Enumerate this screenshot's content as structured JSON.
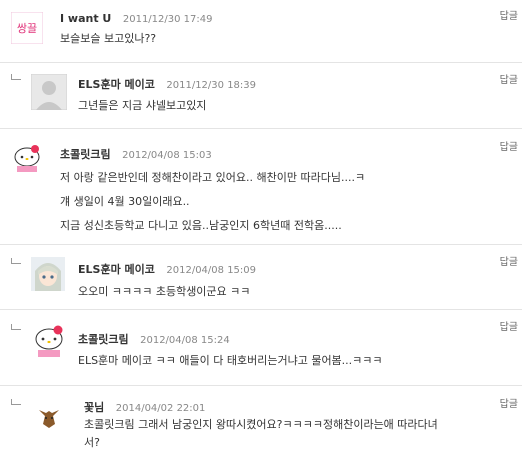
{
  "reply_label": "답글",
  "comments": [
    {
      "author": "I want U",
      "date": "2011/12/30 17:49",
      "lines": [
        "보슬보슬 보고있나??"
      ],
      "avatar": "logo-avatar"
    },
    {
      "author": "ELS훈마 메이코",
      "date": "2011/12/30 18:39",
      "lines": [
        "그년들은 지금 샤넬보고있지"
      ],
      "avatar": "default-avatar"
    },
    {
      "author": "초콜릿크림",
      "date": "2012/04/08 15:03",
      "lines": [
        "저 아랑 같은반인데 정해찬이라고 있어요.. 해찬이만 따라다님....ㅋ",
        "걔 생일이 4월 30일이래요..",
        "지금 성신초등학교 다니고 있음..남궁인지 6학년때 전학옴....."
      ],
      "avatar": "kitty-avatar"
    },
    {
      "author": "ELS훈마 메이코",
      "date": "2012/04/08 15:09",
      "lines": [
        "오오미 ㅋㅋㅋㅋ 초등학생이군요 ㅋㅋ"
      ],
      "avatar": "anime-avatar"
    },
    {
      "author": "초콜릿크림",
      "date": "2012/04/08 15:24",
      "lines": [
        "ELS훈마 메이코  ㅋㅋ 애들이 다 태호버리는거냐고 물어봄...ㅋㅋㅋ"
      ],
      "avatar": "kitty-avatar"
    },
    {
      "author": "꽃님",
      "date": "2014/04/02 22:01",
      "lines": [
        "초콜릿크림   그래서 남궁인지 왕따시켰어요?ㅋㅋㅋㅋ정해찬이라는애 따라다녀",
        "서?"
      ],
      "avatar": "fox-avatar"
    }
  ]
}
